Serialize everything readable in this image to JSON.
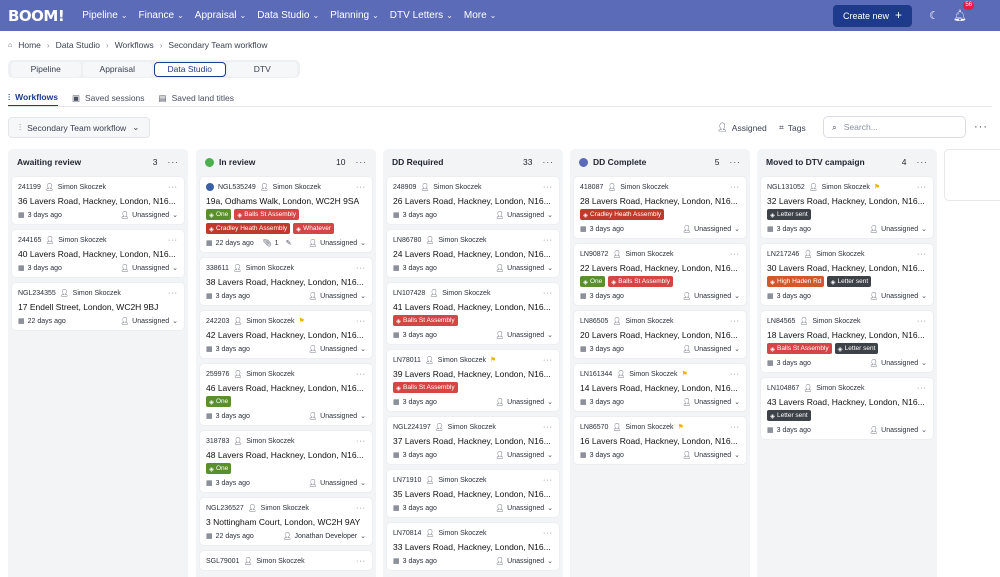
{
  "nav": {
    "logo": "BOOM!",
    "items": [
      "Pipeline",
      "Finance",
      "Appraisal",
      "Data Studio",
      "Planning",
      "DTV Letters",
      "More"
    ],
    "create_label": "Create new",
    "notif_count": "56",
    "accent": "#5b6bb8",
    "button_color": "#1e3a8a"
  },
  "breadcrumb": [
    "Home",
    "Data Studio",
    "Workflows",
    "Secondary Team workflow"
  ],
  "modetabs": [
    "Pipeline",
    "Appraisal",
    "Data Studio",
    "DTV"
  ],
  "subtabs": [
    "Workflows",
    "Saved sessions",
    "Saved land titles"
  ],
  "toolbar": {
    "workflow": "Secondary Team workflow",
    "assigned": "Assigned",
    "tags": "Tags",
    "search_placeholder": "Search..."
  },
  "columns": [
    {
      "title": "Awaiting review",
      "count": "3",
      "dot": "",
      "cards": [
        {
          "ref": "241199",
          "person": "Simon Skoczek",
          "address": "36 Lavers Road, Hackney, London, N16...",
          "time": "3 days ago",
          "assignee": "Unassigned",
          "tags": []
        },
        {
          "ref": "244165",
          "person": "Simon Skoczek",
          "address": "40 Lavers Road, Hackney, London, N16...",
          "time": "3 days ago",
          "assignee": "Unassigned",
          "tags": []
        },
        {
          "ref": "NGL234355",
          "person": "Simon Skoczek",
          "address": "17 Endell Street, London, WC2H 9BJ",
          "time": "22 days ago",
          "assignee": "Unassigned",
          "tags": []
        }
      ]
    },
    {
      "title": "In review",
      "count": "10",
      "dot": "#4caf50",
      "cards": [
        {
          "ref": "NGL535249",
          "person": "Simon Skoczek",
          "address": "19a, Odhams Walk, London, WC2H 9SA",
          "time": "22 days ago",
          "assignee": "Unassigned",
          "circle": true,
          "attach": "1",
          "tags": [
            {
              "label": "One",
              "color": "#5a8f2e"
            },
            {
              "label": "Balls St Assembly",
              "color": "#d64545"
            },
            {
              "label": "Cradley Heath Assembly",
              "color": "#c0392b"
            },
            {
              "label": "Whatever",
              "color": "#d64545"
            }
          ]
        },
        {
          "ref": "338611",
          "person": "Simon Skoczek",
          "address": "38 Lavers Road, Hackney, London, N16...",
          "time": "3 days ago",
          "assignee": "Unassigned",
          "tags": []
        },
        {
          "ref": "242203",
          "person": "Simon Skoczek",
          "address": "42 Lavers Road, Hackney, London, N16...",
          "time": "3 days ago",
          "assignee": "Unassigned",
          "star": true,
          "tags": []
        },
        {
          "ref": "259976",
          "person": "Simon Skoczek",
          "address": "46 Lavers Road, Hackney, London, N16...",
          "time": "3 days ago",
          "assignee": "Unassigned",
          "tags": [
            {
              "label": "One",
              "color": "#5a8f2e"
            }
          ]
        },
        {
          "ref": "318783",
          "person": "Simon Skoczek",
          "address": "48 Lavers Road, Hackney, London, N16...",
          "time": "3 days ago",
          "assignee": "Unassigned",
          "tags": [
            {
              "label": "One",
              "color": "#5a8f2e"
            }
          ]
        },
        {
          "ref": "NGL236527",
          "person": "Simon Skoczek",
          "address": "3 Nottingham Court, London, WC2H 9AY",
          "time": "22 days ago",
          "assignee": "Jonathan Developer",
          "tags": []
        },
        {
          "ref": "SGL79001",
          "person": "Simon Skoczek",
          "address": "",
          "time": "",
          "assignee": "",
          "tags": []
        }
      ]
    },
    {
      "title": "DD Required",
      "count": "33",
      "dot": "",
      "cards": [
        {
          "ref": "248909",
          "person": "Simon Skoczek",
          "address": "26 Lavers Road, Hackney, London, N16...",
          "time": "3 days ago",
          "assignee": "Unassigned",
          "tags": []
        },
        {
          "ref": "LN86780",
          "person": "Simon Skoczek",
          "address": "24 Lavers Road, Hackney, London, N16...",
          "time": "3 days ago",
          "assignee": "Unassigned",
          "tags": []
        },
        {
          "ref": "LN107428",
          "person": "Simon Skoczek",
          "address": "41 Lavers Road, Hackney, London, N16...",
          "time": "3 days ago",
          "assignee": "Unassigned",
          "tags": [
            {
              "label": "Balls St Assembly",
              "color": "#d64545"
            }
          ]
        },
        {
          "ref": "LN78011",
          "person": "Simon Skoczek",
          "address": "39 Lavers Road, Hackney, London, N16...",
          "time": "3 days ago",
          "assignee": "Unassigned",
          "star": true,
          "tags": [
            {
              "label": "Balls St Assembly",
              "color": "#d64545"
            }
          ]
        },
        {
          "ref": "NGL224197",
          "person": "Simon Skoczek",
          "address": "37 Lavers Road, Hackney, London, N16...",
          "time": "3 days ago",
          "assignee": "Unassigned",
          "tags": []
        },
        {
          "ref": "LN71910",
          "person": "Simon Skoczek",
          "address": "35 Lavers Road, Hackney, London, N16...",
          "time": "3 days ago",
          "assignee": "Unassigned",
          "tags": []
        },
        {
          "ref": "LN70814",
          "person": "Simon Skoczek",
          "address": "33 Lavers Road, Hackney, London, N16...",
          "time": "3 days ago",
          "assignee": "Unassigned",
          "tags": []
        }
      ]
    },
    {
      "title": "DD Complete",
      "count": "5",
      "dot": "#5b6bb8",
      "cards": [
        {
          "ref": "418087",
          "person": "Simon Skoczek",
          "address": "28 Lavers Road, Hackney, London, N16...",
          "time": "3 days ago",
          "assignee": "Unassigned",
          "tags": [
            {
              "label": "Cradley Heath Assembly",
              "color": "#c0392b"
            }
          ]
        },
        {
          "ref": "LN90872",
          "person": "Simon Skoczek",
          "address": "22 Lavers Road, Hackney, London, N16...",
          "time": "3 days ago",
          "assignee": "Unassigned",
          "tags": [
            {
              "label": "One",
              "color": "#5a8f2e"
            },
            {
              "label": "Balls St Assembly",
              "color": "#d64545"
            }
          ]
        },
        {
          "ref": "LN86505",
          "person": "Simon Skoczek",
          "address": "20 Lavers Road, Hackney, London, N16...",
          "time": "3 days ago",
          "assignee": "Unassigned",
          "tags": []
        },
        {
          "ref": "LN161344",
          "person": "Simon Skoczek",
          "address": "14 Lavers Road, Hackney, London, N16...",
          "time": "3 days ago",
          "assignee": "Unassigned",
          "star": true,
          "tags": []
        },
        {
          "ref": "LN86570",
          "person": "Simon Skoczek",
          "address": "16 Lavers Road, Hackney, London, N16...",
          "time": "3 days ago",
          "assignee": "Unassigned",
          "star": true,
          "tags": []
        }
      ]
    },
    {
      "title": "Moved to DTV campaign",
      "count": "4",
      "dot": "",
      "cards": [
        {
          "ref": "NGL131052",
          "person": "Simon Skoczek",
          "address": "32 Lavers Road, Hackney, London, N16...",
          "time": "3 days ago",
          "assignee": "Unassigned",
          "star": true,
          "tags": [
            {
              "label": "Letter sent",
              "color": "#3d4148"
            }
          ]
        },
        {
          "ref": "LN217246",
          "person": "Simon Skoczek",
          "address": "30 Lavers Road, Hackney, London, N16...",
          "time": "3 days ago",
          "assignee": "Unassigned",
          "tags": [
            {
              "label": "High Haden Rd",
              "color": "#d4572a"
            },
            {
              "label": "Letter sent",
              "color": "#3d4148"
            }
          ]
        },
        {
          "ref": "LN84565",
          "person": "Simon Skoczek",
          "address": "18 Lavers Road, Hackney, London, N16...",
          "time": "3 days ago",
          "assignee": "Unassigned",
          "tags": [
            {
              "label": "Balls St Assembly",
              "color": "#d64545"
            },
            {
              "label": "Letter sent",
              "color": "#3d4148"
            }
          ]
        },
        {
          "ref": "LN104867",
          "person": "Simon Skoczek",
          "address": "43 Lavers Road, Hackney, London, N16...",
          "time": "3 days ago",
          "assignee": "Unassigned",
          "tags": [
            {
              "label": "Letter sent",
              "color": "#3d4148"
            }
          ]
        }
      ]
    }
  ]
}
